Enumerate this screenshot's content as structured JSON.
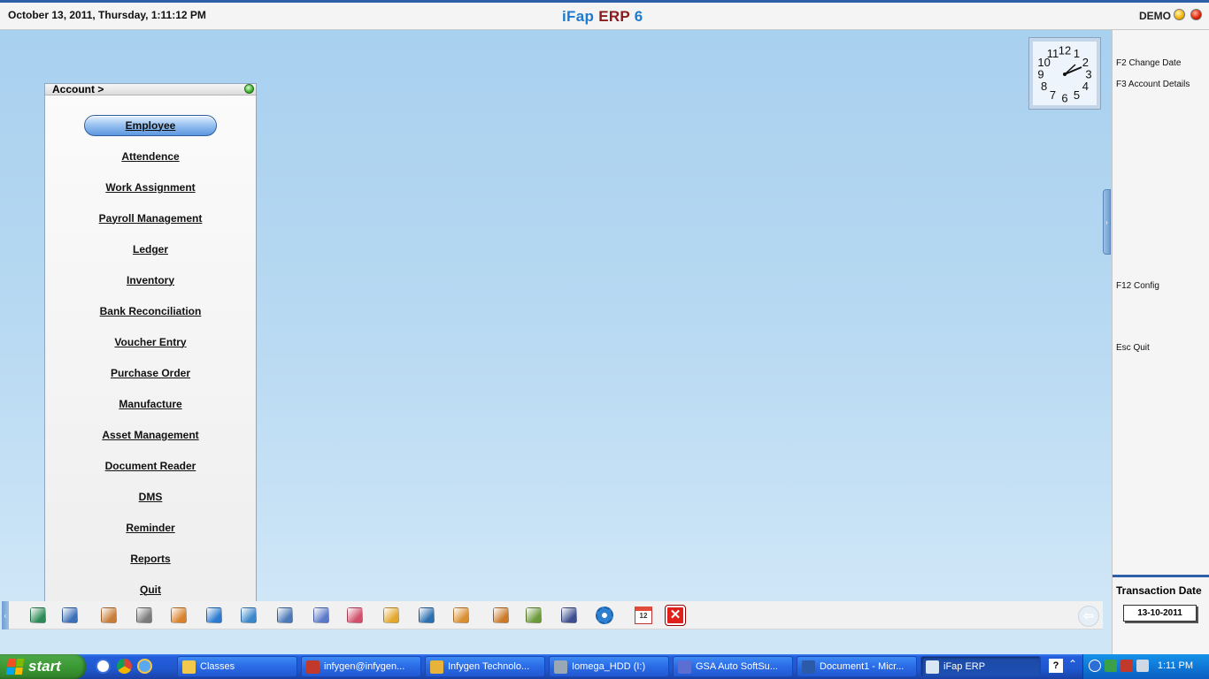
{
  "header": {
    "datetime": "October  13, 2011, Thursday, 1:11:12 PM",
    "title_part1": "iFap",
    "title_part2": "ERP",
    "title_part3": "6",
    "user": "DEMO"
  },
  "panel": {
    "title": "Account >",
    "items": [
      {
        "label": "Employee",
        "active": true
      },
      {
        "label": "Attendence"
      },
      {
        "label": "Work Assignment"
      },
      {
        "label": "Payroll Management"
      },
      {
        "label": "Ledger"
      },
      {
        "label": "Inventory"
      },
      {
        "label": "Bank Reconciliation"
      },
      {
        "label": "Voucher Entry"
      },
      {
        "label": "Purchase Order"
      },
      {
        "label": "Manufacture"
      },
      {
        "label": "Asset Management"
      },
      {
        "label": "Document Reader"
      },
      {
        "label": "DMS"
      },
      {
        "label": "Reminder"
      },
      {
        "label": "Reports"
      },
      {
        "label": "Quit"
      }
    ]
  },
  "shortcuts": {
    "f2": "F2 Change Date",
    "f3": "F3 Account Details",
    "f12": "F12 Config",
    "esc": "Esc Quit"
  },
  "transaction": {
    "label": "Transaction Date",
    "value": "13-10-2011"
  },
  "toolbar_icons": [
    "stack-icon",
    "user-icon",
    "people-icon",
    "gear-cluster-icon",
    "book-icon",
    "cart-icon",
    "refresh-icon",
    "window-icon",
    "document-icon",
    "chart-icon",
    "folder-tree-icon",
    "network-icon",
    "box-icon",
    "stopwatch-icon",
    "checklist-icon",
    "save-icon",
    "settings-icon",
    "calendar-icon",
    "close-icon"
  ],
  "calendar_day": "12",
  "clock": {
    "numerals": [
      "12",
      "1",
      "2",
      "3",
      "4",
      "5",
      "6",
      "7",
      "8",
      "9",
      "10",
      "11"
    ]
  },
  "taskbar": {
    "start_label": "start",
    "items": [
      {
        "label": "Classes",
        "icon": "folder-icon",
        "color": "#f2c94c"
      },
      {
        "label": "infygen@infygen...",
        "icon": "filezilla-icon",
        "color": "#c0392b"
      },
      {
        "label": "Infygen Technolo...",
        "icon": "chrome-icon",
        "color": "#e8b33a"
      },
      {
        "label": "Iomega_HDD (I:)",
        "icon": "drive-icon",
        "color": "#9aa7b5"
      },
      {
        "label": "GSA Auto SoftSu...",
        "icon": "app-icon",
        "color": "#5a6fd1"
      },
      {
        "label": "Document1 - Micr...",
        "icon": "word-icon",
        "color": "#2b5aa8"
      },
      {
        "label": "iFap ERP",
        "icon": "ifap-icon",
        "color": "#d9e6f3",
        "active": true
      }
    ],
    "time": "1:11 PM",
    "help": "?"
  }
}
